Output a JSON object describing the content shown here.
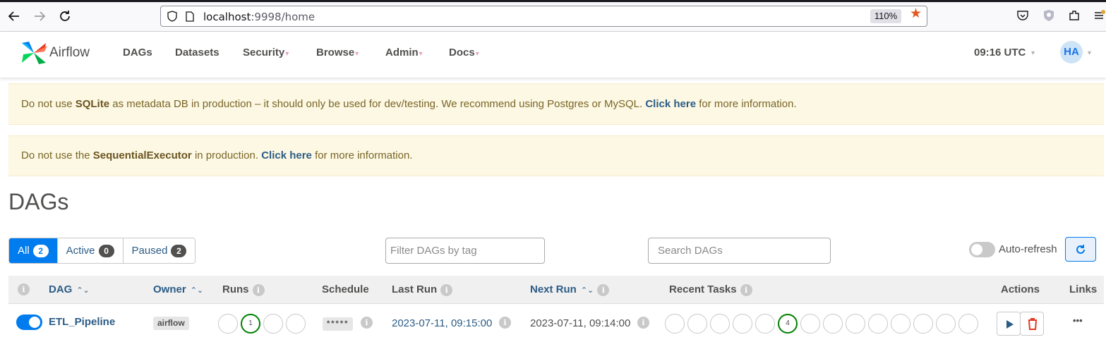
{
  "browser": {
    "url_host": "localhost",
    "url_rest": ":9998/home",
    "zoom": "110%"
  },
  "navbar": {
    "brand": "Airflow",
    "menu": [
      {
        "label": "DAGs",
        "dropdown": false
      },
      {
        "label": "Datasets",
        "dropdown": false
      },
      {
        "label": "Security",
        "dropdown": true
      },
      {
        "label": "Browse",
        "dropdown": true
      },
      {
        "label": "Admin",
        "dropdown": true
      },
      {
        "label": "Docs",
        "dropdown": true
      }
    ],
    "clock": "09:16 UTC",
    "user_initials": "HA"
  },
  "alerts": {
    "sqlite": {
      "pre": "Do not use ",
      "bold": "SQLite",
      "mid": " as metadata DB in production – it should only be used for dev/testing. We recommend using Postgres or MySQL. ",
      "link": "Click here",
      "post": " for more information."
    },
    "executor": {
      "pre": "Do not use the ",
      "bold": "SequentialExecutor",
      "mid": " in production. ",
      "link": "Click here",
      "post": " for more information."
    }
  },
  "page_title": "DAGs",
  "filters": {
    "all_label": "All",
    "all_count": "2",
    "active_label": "Active",
    "active_count": "0",
    "paused_label": "Paused",
    "paused_count": "2",
    "tag_placeholder": "Filter DAGs by tag",
    "search_placeholder": "Search DAGs",
    "autorefresh_label": "Auto-refresh",
    "autorefresh_on": false
  },
  "table": {
    "headers": {
      "dag": "DAG",
      "owner": "Owner",
      "runs": "Runs",
      "schedule": "Schedule",
      "last_run": "Last Run",
      "next_run": "Next Run",
      "recent_tasks": "Recent Tasks",
      "actions": "Actions",
      "links": "Links"
    },
    "rows": [
      {
        "enabled": true,
        "dag_id": "ETL_Pipeline",
        "owner": "airflow",
        "runs": [
          "",
          "1",
          "",
          ""
        ],
        "runs_success_index": 1,
        "schedule": "*****",
        "last_run": "2023-07-11, 09:15:00",
        "next_run": "2023-07-11, 09:14:00",
        "recent_tasks": [
          "",
          "",
          "",
          "",
          "",
          "4",
          "",
          "",
          "",
          "",
          "",
          "",
          "",
          ""
        ],
        "recent_tasks_success_index": 5,
        "links_label": "•••"
      }
    ]
  },
  "colors": {
    "primary": "#017cee",
    "success": "#008000",
    "alert_bg": "#fcf8e3",
    "link": "#2c5c86"
  }
}
